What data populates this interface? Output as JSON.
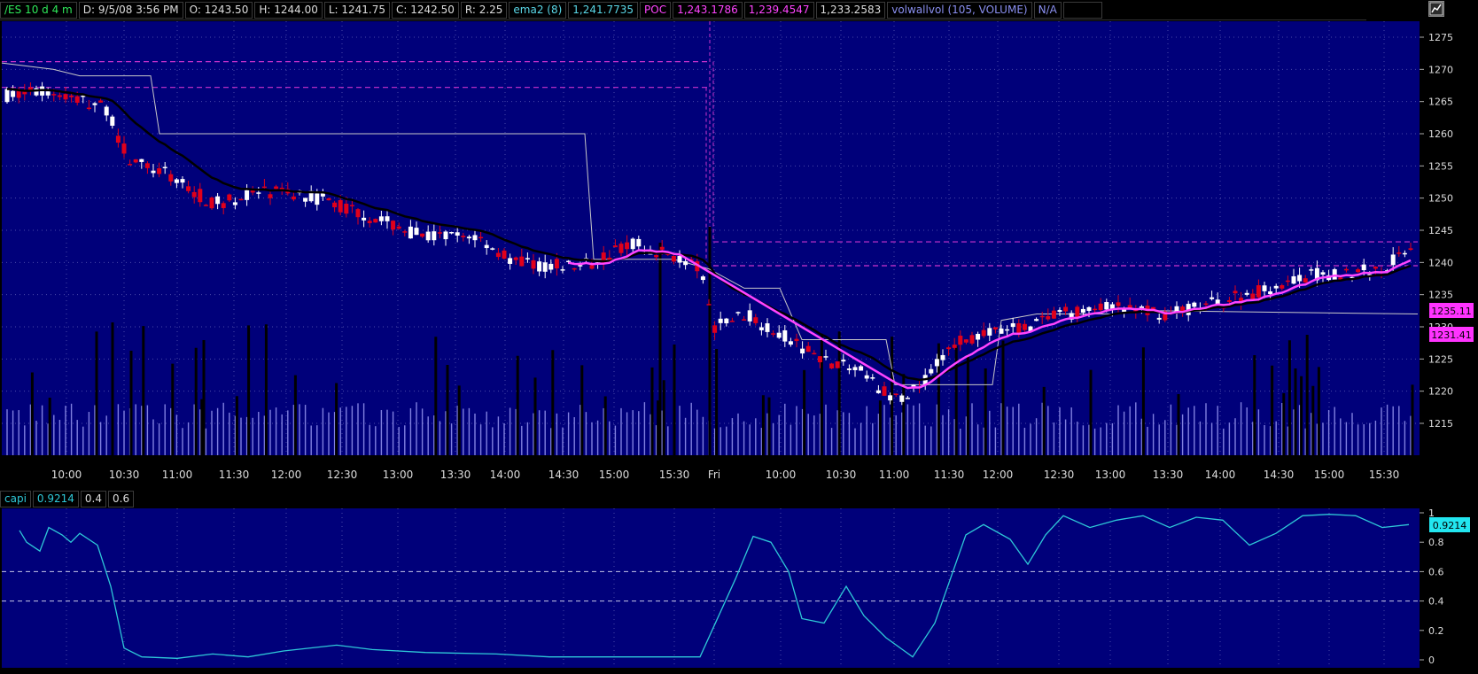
{
  "header": {
    "symbol": "/ES 10 d 4 m",
    "date_time": "D: 9/5/08 3:56 PM",
    "open": "O: 1243.50",
    "high": "H: 1244.00",
    "low": "L: 1241.75",
    "close": "C: 1242.50",
    "range": "R: 2.25",
    "ema_label": "ema2 (8)",
    "ema_value": "1,241.7735",
    "poc_label": "POC",
    "poc_value1": "1,243.1786",
    "poc_value2": "1,239.4547",
    "value3": "1,233.2583",
    "vol_label": "volwallvol (105, VOLUME)",
    "vol_value": "N/A"
  },
  "price_axis": {
    "ticks": [
      "1275",
      "1270",
      "1265",
      "1260",
      "1255",
      "1250",
      "1245",
      "1240",
      "1235",
      "1230",
      "1225",
      "1220",
      "1215"
    ],
    "marker_upper": "1235.11",
    "marker_lower": "1231.41"
  },
  "time_axis": {
    "labels": [
      "10:00",
      "10:30",
      "11:00",
      "11:30",
      "12:00",
      "12:30",
      "13:00",
      "13:30",
      "14:00",
      "14:30",
      "15:00",
      "15:30",
      "Fri",
      "10:00",
      "10:30",
      "11:00",
      "11:30",
      "12:00",
      "12:30",
      "13:00",
      "13:30",
      "14:00",
      "14:30",
      "15:00",
      "15:30"
    ]
  },
  "lower_panel": {
    "name": "capi",
    "value": "0.9214",
    "level1": "0.4",
    "level2": "0.6",
    "marker": "0.9214",
    "ticks": [
      "1",
      "0.8",
      "0.6",
      "0.4",
      "0.2",
      "0"
    ]
  },
  "colors": {
    "background": "#00007a",
    "grid": "#4a4aa8",
    "up": "#ffffff",
    "down": "#e0001b",
    "ema": "#ff44ff",
    "poc": "#cc33cc",
    "capi": "#2ec8d8",
    "volume": "#8080e0"
  }
}
